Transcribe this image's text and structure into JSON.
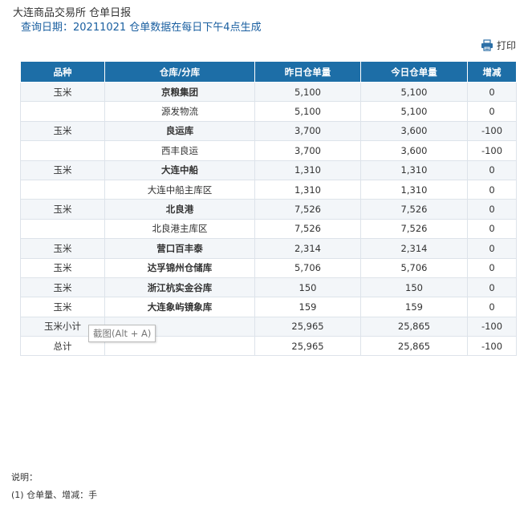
{
  "header": {
    "title": "大连商品交易所 仓单日报",
    "query_date": "查询日期：20211021 仓单数据在每日下午4点生成"
  },
  "toolbar": {
    "print_label": "打印",
    "print_icon": "printer-icon"
  },
  "table": {
    "columns": [
      "品种",
      "仓库/分库",
      "昨日仓单量",
      "今日仓单量",
      "增减"
    ],
    "rows": [
      {
        "variety": "玉米",
        "warehouse": "京粮集团",
        "yesterday": "5,100",
        "today": "5,100",
        "change": "0",
        "bold": true
      },
      {
        "variety": "",
        "warehouse": "源发物流",
        "yesterday": "5,100",
        "today": "5,100",
        "change": "0",
        "bold": false
      },
      {
        "variety": "玉米",
        "warehouse": "良运库",
        "yesterday": "3,700",
        "today": "3,600",
        "change": "-100",
        "bold": true
      },
      {
        "variety": "",
        "warehouse": "西丰良运",
        "yesterday": "3,700",
        "today": "3,600",
        "change": "-100",
        "bold": false
      },
      {
        "variety": "玉米",
        "warehouse": "大连中船",
        "yesterday": "1,310",
        "today": "1,310",
        "change": "0",
        "bold": true
      },
      {
        "variety": "",
        "warehouse": "大连中船主库区",
        "yesterday": "1,310",
        "today": "1,310",
        "change": "0",
        "bold": false
      },
      {
        "variety": "玉米",
        "warehouse": "北良港",
        "yesterday": "7,526",
        "today": "7,526",
        "change": "0",
        "bold": true
      },
      {
        "variety": "",
        "warehouse": "北良港主库区",
        "yesterday": "7,526",
        "today": "7,526",
        "change": "0",
        "bold": false
      },
      {
        "variety": "玉米",
        "warehouse": "营口百丰泰",
        "yesterday": "2,314",
        "today": "2,314",
        "change": "0",
        "bold": true
      },
      {
        "variety": "玉米",
        "warehouse": "达孚锦州仓储库",
        "yesterday": "5,706",
        "today": "5,706",
        "change": "0",
        "bold": true
      },
      {
        "variety": "玉米",
        "warehouse": "浙江杭实金谷库",
        "yesterday": "150",
        "today": "150",
        "change": "0",
        "bold": true
      },
      {
        "variety": "玉米",
        "warehouse": "大连象屿镜象库",
        "yesterday": "159",
        "today": "159",
        "change": "0",
        "bold": true
      },
      {
        "variety": "玉米小计",
        "warehouse": "",
        "yesterday": "25,965",
        "today": "25,865",
        "change": "-100",
        "bold": false
      },
      {
        "variety": "总计",
        "warehouse": "",
        "yesterday": "25,965",
        "today": "25,865",
        "change": "-100",
        "bold": false
      }
    ]
  },
  "tooltip": "截图(Alt + A)",
  "notes": {
    "label": "说明：",
    "line1": "(1) 仓单量、增减：手"
  },
  "colors": {
    "header_bg": "#1d6ea7",
    "accent_text": "#1a5fa0",
    "alt_row": "#f3f6f9"
  }
}
